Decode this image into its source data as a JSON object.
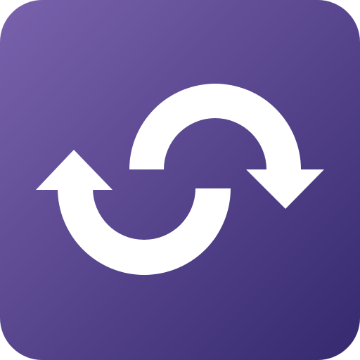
{
  "icon": {
    "name": "swap-arrows-icon",
    "colors": {
      "background_start": "#7a62ad",
      "background_end": "#35296f",
      "arrow": "#ffffff"
    }
  }
}
